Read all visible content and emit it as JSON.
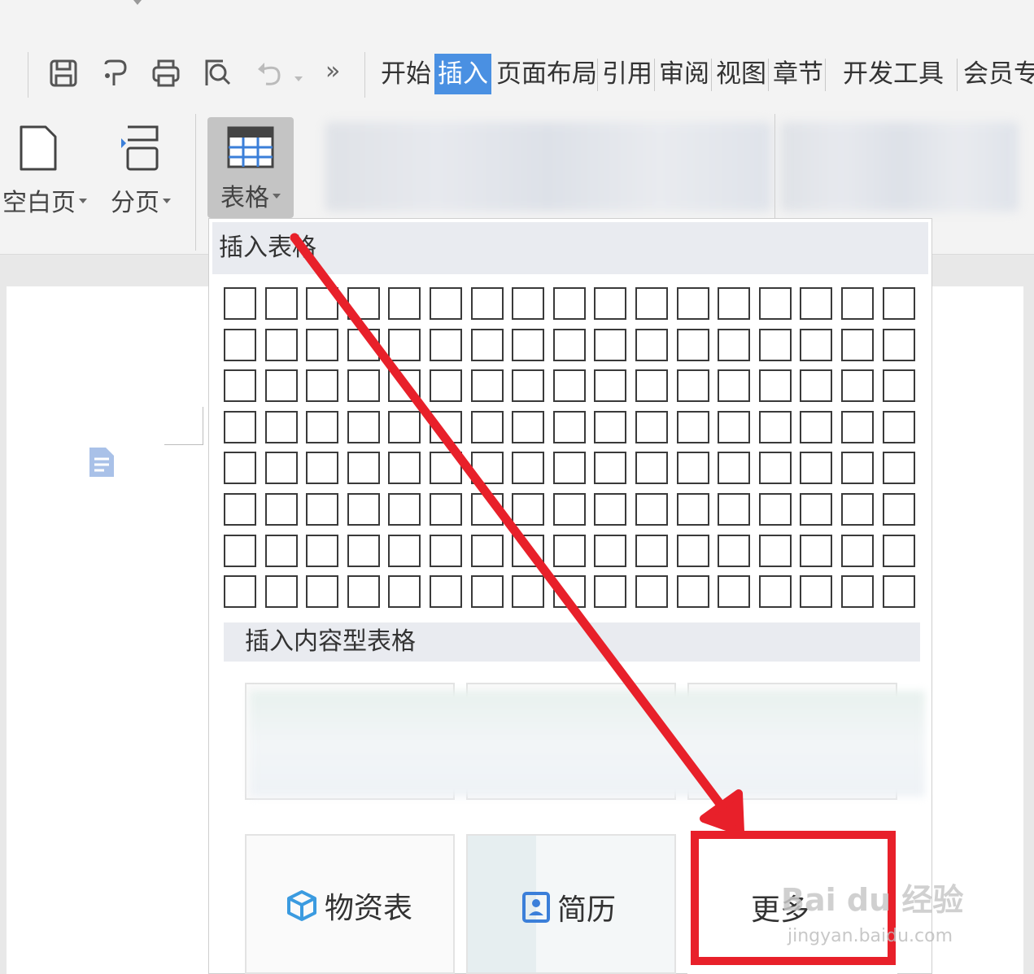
{
  "tabs": [
    {
      "id": "start",
      "label": "开始"
    },
    {
      "id": "insert",
      "label": "插入",
      "active": true
    },
    {
      "id": "layout",
      "label": "页面布局"
    },
    {
      "id": "reference",
      "label": "引用"
    },
    {
      "id": "review",
      "label": "审阅"
    },
    {
      "id": "view",
      "label": "视图"
    },
    {
      "id": "chapter",
      "label": "章节"
    },
    {
      "id": "developer",
      "label": "开发工具"
    },
    {
      "id": "member",
      "label": "会员专"
    }
  ],
  "quick_access": {
    "icons": [
      "save-icon",
      "format-painter-icon",
      "print-icon",
      "print-preview-icon",
      "undo-icon",
      "more-icon"
    ],
    "more_label": "»"
  },
  "ribbon": {
    "blank_page_label": "空白页",
    "page_break_label": "分页",
    "table_label": "表格"
  },
  "panel": {
    "insert_table_title": "插入表格",
    "grid": {
      "rows": 8,
      "cols": 17
    },
    "content_table_title": "插入内容型表格",
    "templates": [
      {
        "id": "materials",
        "label": "物资表",
        "icon": "cube-icon"
      },
      {
        "id": "resume",
        "label": "简历",
        "icon": "resume-icon"
      },
      {
        "id": "more",
        "label": "更多"
      }
    ]
  },
  "watermark": {
    "main": "Bai du 经验",
    "sub": "jingyan.baidu.com"
  },
  "colors": {
    "accent": "#4a90e2",
    "annotation": "#e8202a",
    "table_icon": "#3b7fd9"
  }
}
